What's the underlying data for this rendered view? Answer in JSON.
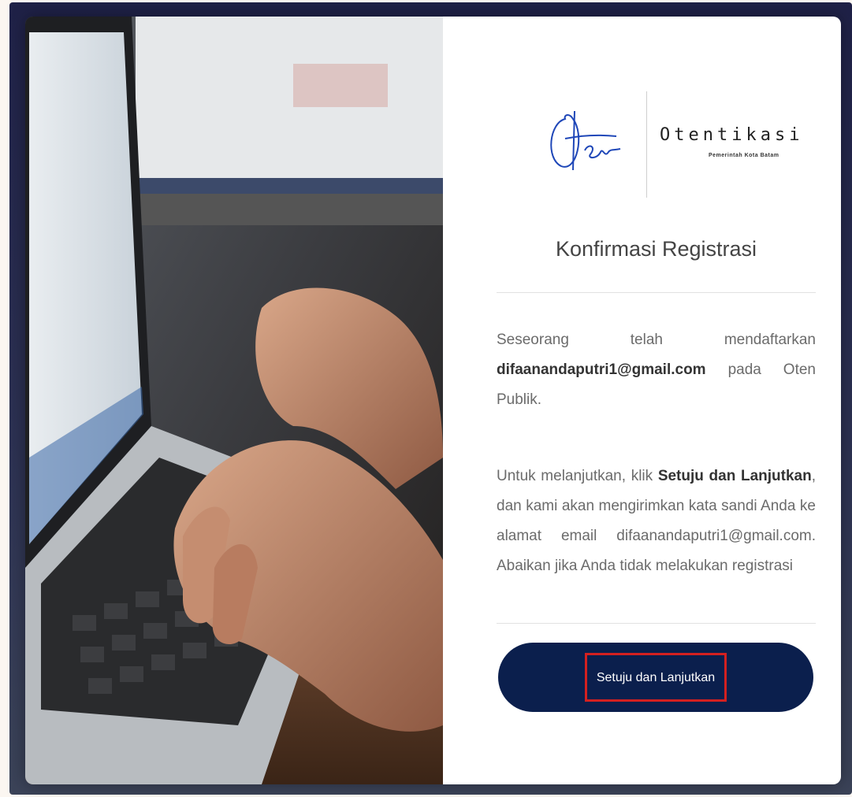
{
  "logo": {
    "title": "Otentikasi",
    "subtitle": "Pemerintah Kota Batam",
    "signature_color": "#1f47b8"
  },
  "heading": "Konfirmasi Registrasi",
  "paragraph1": {
    "part1": "Seseorang telah mendaftarkan",
    "email": "difaanandaputri1@gmail.com",
    "part2": "pada Oten Publik."
  },
  "paragraph2": {
    "part1": "Untuk melanjutkan, klik",
    "action": "Setuju dan Lanjutkan",
    "part2": ", dan kami akan mengirimkan kata sandi Anda ke alamat email difaanandaputri1@gmail.com. Abaikan jika Anda tidak melakukan registrasi"
  },
  "button": {
    "label": "Setuju dan Lanjutkan",
    "bg_color": "#0b1f4d",
    "highlight_color": "#d42020"
  },
  "photo": {
    "icon": "laptop-typing-photo"
  }
}
